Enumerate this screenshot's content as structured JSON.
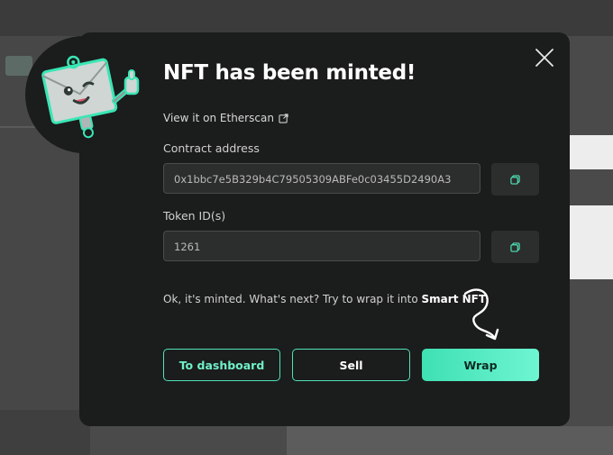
{
  "modal": {
    "title": "NFT has been minted!",
    "etherscan_link": "View it on Etherscan",
    "contract_label": "Contract address",
    "contract_value": "0x1bbc7e5B329b4C79505309ABFe0c03455D2490A3",
    "token_label": "Token ID(s)",
    "token_value": "1261",
    "hint_prefix": "Ok, it's minted. What's next? Try to wrap it into ",
    "hint_highlight": "Smart NFT",
    "buttons": {
      "dashboard": "To dashboard",
      "sell": "Sell",
      "wrap": "Wrap"
    }
  },
  "icons": {
    "close": "close-icon",
    "external_link": "external-link-icon",
    "copy": "copy-icon",
    "mascot": "envelope-robot-mascot",
    "arrow": "curly-arrow-icon"
  },
  "colors": {
    "accent": "#4fe3b8",
    "modal_bg": "#1b1c1c",
    "field_bg": "#2c2d2d"
  }
}
